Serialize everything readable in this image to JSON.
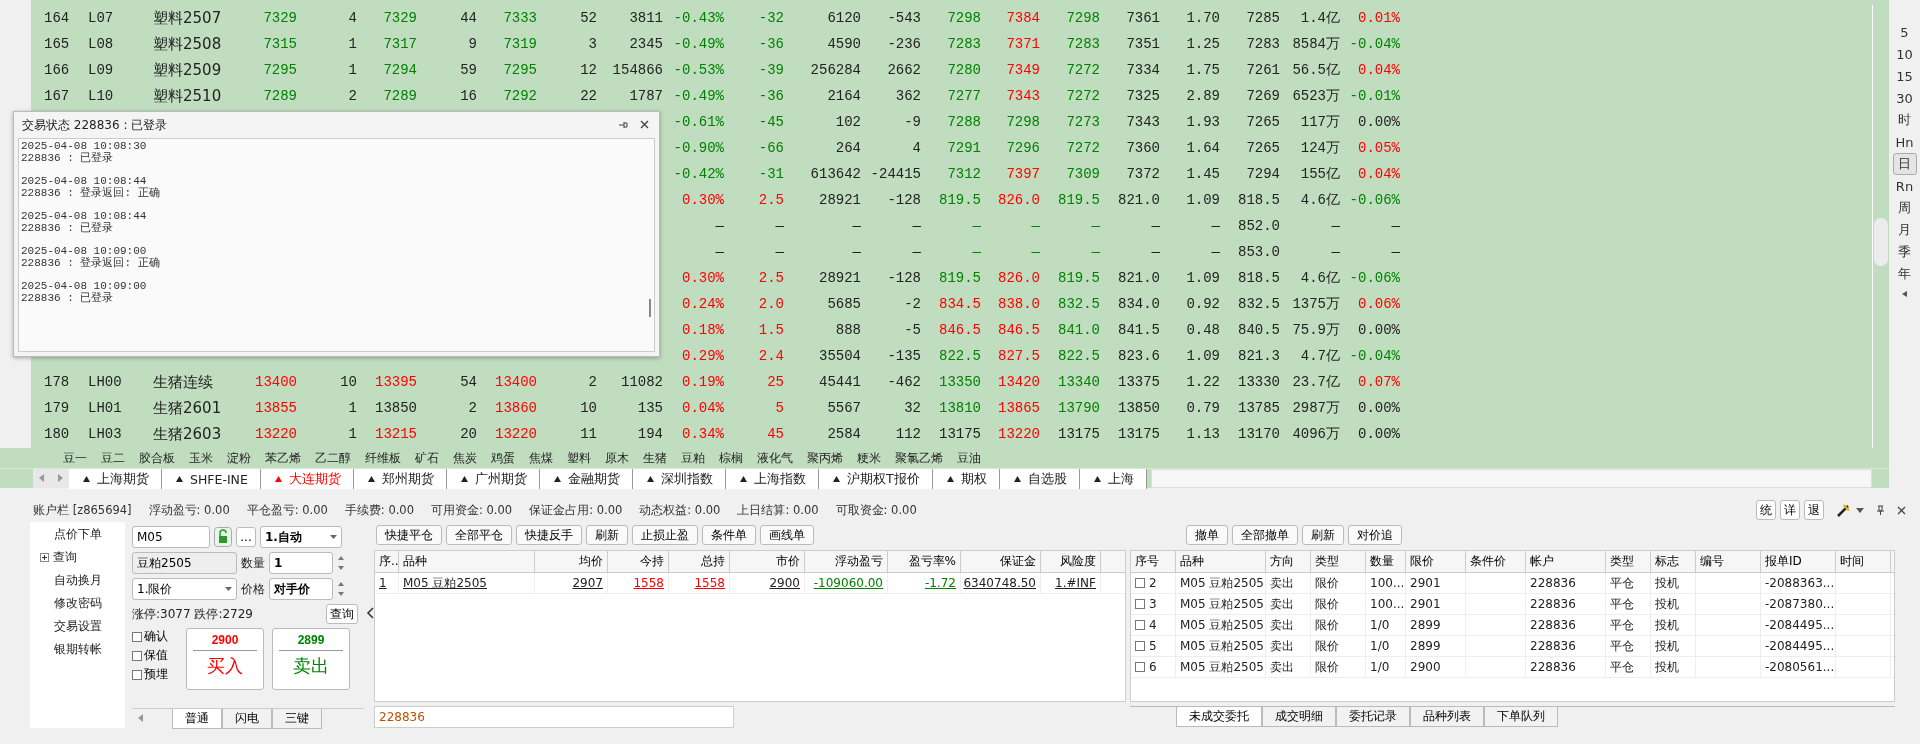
{
  "quotes": {
    "rows": [
      {
        "cells": [
          "164",
          "L07",
          "塑料2507",
          {
            "text": "7329",
            "color": "#008000"
          },
          "4",
          {
            "text": "7329",
            "color": "#008000"
          },
          "44",
          {
            "text": "7333",
            "color": "#008000"
          },
          "52",
          "3811",
          {
            "text": "-0.43%",
            "color": "#008000"
          },
          {
            "text": "-32",
            "color": "#008000"
          },
          "6120",
          "-543",
          {
            "text": "7298",
            "color": "#008000"
          },
          {
            "text": "7384",
            "color": "#ff0000"
          },
          {
            "text": "7298",
            "color": "#008000"
          },
          "7361",
          "1.70",
          "7285",
          "1.4亿",
          {
            "text": "0.01%",
            "color": "#ff0000"
          }
        ]
      },
      {
        "cells": [
          "165",
          "L08",
          "塑料2508",
          {
            "text": "7315",
            "color": "#008000"
          },
          "1",
          {
            "text": "7317",
            "color": "#008000"
          },
          "9",
          {
            "text": "7319",
            "color": "#008000"
          },
          "3",
          "2345",
          {
            "text": "-0.49%",
            "color": "#008000"
          },
          {
            "text": "-36",
            "color": "#008000"
          },
          "4590",
          "-236",
          {
            "text": "7283",
            "color": "#008000"
          },
          {
            "text": "7371",
            "color": "#ff0000"
          },
          {
            "text": "7283",
            "color": "#008000"
          },
          "7351",
          "1.25",
          "7283",
          "8584万",
          {
            "text": "-0.04%",
            "color": "#008000"
          }
        ]
      },
      {
        "cells": [
          "166",
          "L09",
          "塑料2509",
          {
            "text": "7295",
            "color": "#008000"
          },
          "1",
          {
            "text": "7294",
            "color": "#008000"
          },
          "59",
          {
            "text": "7295",
            "color": "#008000"
          },
          "12",
          "154866",
          {
            "text": "-0.53%",
            "color": "#008000"
          },
          {
            "text": "-39",
            "color": "#008000"
          },
          "256284",
          "2662",
          {
            "text": "7280",
            "color": "#008000"
          },
          {
            "text": "7349",
            "color": "#ff0000"
          },
          {
            "text": "7272",
            "color": "#008000"
          },
          "7334",
          "1.75",
          "7261",
          "56.5亿",
          {
            "text": "0.04%",
            "color": "#ff0000"
          }
        ]
      },
      {
        "cells": [
          "167",
          "L10",
          "塑料2510",
          {
            "text": "7289",
            "color": "#008000"
          },
          "2",
          {
            "text": "7289",
            "color": "#008000"
          },
          "16",
          {
            "text": "7292",
            "color": "#008000"
          },
          "22",
          "1787",
          {
            "text": "-0.49%",
            "color": "#008000"
          },
          {
            "text": "-36",
            "color": "#008000"
          },
          "2164",
          "362",
          {
            "text": "7277",
            "color": "#008000"
          },
          {
            "text": "7343",
            "color": "#ff0000"
          },
          {
            "text": "7272",
            "color": "#008000"
          },
          "7325",
          "2.89",
          "7269",
          "6523万",
          {
            "text": "-0.01%",
            "color": "#008000"
          }
        ]
      },
      {
        "cells": [
          {
            "text": "-0.61%",
            "color": "#008000"
          },
          {
            "text": "-45",
            "color": "#008000"
          },
          "102",
          "-9",
          {
            "text": "7288",
            "color": "#008000"
          },
          {
            "text": "7298",
            "color": "#008000"
          },
          {
            "text": "7273",
            "color": "#008000"
          },
          "7343",
          "1.93",
          "7265",
          "117万",
          "0.00%"
        ]
      },
      {
        "cells": [
          {
            "text": "-0.90%",
            "color": "#008000"
          },
          {
            "text": "-66",
            "color": "#008000"
          },
          "264",
          "4",
          {
            "text": "7291",
            "color": "#008000"
          },
          {
            "text": "7296",
            "color": "#008000"
          },
          {
            "text": "7272",
            "color": "#008000"
          },
          "7360",
          "1.64",
          "7265",
          "124万",
          {
            "text": "0.05%",
            "color": "#ff0000"
          }
        ]
      },
      {
        "cells": [
          {
            "text": "-0.42%",
            "color": "#008000"
          },
          {
            "text": "-31",
            "color": "#008000"
          },
          "613642",
          "-24415",
          {
            "text": "7312",
            "color": "#008000"
          },
          {
            "text": "7397",
            "color": "#ff0000"
          },
          {
            "text": "7309",
            "color": "#008000"
          },
          "7372",
          "1.45",
          "7294",
          "155亿",
          {
            "text": "0.04%",
            "color": "#ff0000"
          }
        ]
      },
      {
        "cells": [
          {
            "text": "0.30%",
            "color": "#ff0000"
          },
          {
            "text": "2.5",
            "color": "#ff0000"
          },
          "28921",
          "-128",
          {
            "text": "819.5",
            "color": "#008000"
          },
          {
            "text": "826.0",
            "color": "#ff0000"
          },
          {
            "text": "819.5",
            "color": "#008000"
          },
          "821.0",
          "1.09",
          "818.5",
          "4.6亿",
          {
            "text": "-0.06%",
            "color": "#008000"
          }
        ]
      },
      {
        "cells": [
          "—",
          "—",
          "—",
          "—",
          {
            "text": "—",
            "color": "#008000"
          },
          {
            "text": "—",
            "color": "#008000"
          },
          {
            "text": "—",
            "color": "#008000"
          },
          "—",
          "—",
          "852.0",
          "—",
          "—"
        ]
      },
      {
        "cells": [
          "—",
          "—",
          "—",
          "—",
          {
            "text": "—",
            "color": "#008000"
          },
          {
            "text": "—",
            "color": "#008000"
          },
          {
            "text": "—",
            "color": "#008000"
          },
          "—",
          "—",
          "853.0",
          "—",
          "—"
        ]
      },
      {
        "cells": [
          {
            "text": "0.30%",
            "color": "#ff0000"
          },
          {
            "text": "2.5",
            "color": "#ff0000"
          },
          "28921",
          "-128",
          {
            "text": "819.5",
            "color": "#008000"
          },
          {
            "text": "826.0",
            "color": "#ff0000"
          },
          {
            "text": "819.5",
            "color": "#008000"
          },
          "821.0",
          "1.09",
          "818.5",
          "4.6亿",
          {
            "text": "-0.06%",
            "color": "#008000"
          }
        ]
      },
      {
        "cells": [
          {
            "text": "0.24%",
            "color": "#ff0000"
          },
          {
            "text": "2.0",
            "color": "#ff0000"
          },
          "5685",
          "-2",
          {
            "text": "834.5",
            "color": "#ff0000"
          },
          {
            "text": "838.0",
            "color": "#ff0000"
          },
          {
            "text": "832.5",
            "color": "#008000"
          },
          "834.0",
          "0.92",
          "832.5",
          "1375万",
          {
            "text": "0.06%",
            "color": "#ff0000"
          }
        ]
      },
      {
        "cells": [
          {
            "text": "0.18%",
            "color": "#ff0000"
          },
          {
            "text": "1.5",
            "color": "#ff0000"
          },
          "888",
          "-5",
          {
            "text": "846.5",
            "color": "#ff0000"
          },
          {
            "text": "846.5",
            "color": "#ff0000"
          },
          {
            "text": "841.0",
            "color": "#008000"
          },
          "841.5",
          "0.48",
          "840.5",
          "75.9万",
          "0.00%"
        ]
      },
      {
        "cells": [
          {
            "text": "0.29%",
            "color": "#ff0000"
          },
          {
            "text": "2.4",
            "color": "#ff0000"
          },
          "35504",
          "-135",
          {
            "text": "822.5",
            "color": "#008000"
          },
          {
            "text": "827.5",
            "color": "#ff0000"
          },
          {
            "text": "822.5",
            "color": "#008000"
          },
          "823.6",
          "1.09",
          "821.3",
          "4.7亿",
          {
            "text": "-0.04%",
            "color": "#008000"
          }
        ]
      },
      {
        "cells": [
          "178",
          "LH00",
          "生猪连续",
          {
            "text": "13400",
            "color": "#ff0000"
          },
          "10",
          {
            "text": "13395",
            "color": "#ff0000"
          },
          "54",
          {
            "text": "13400",
            "color": "#ff0000"
          },
          "2",
          "11082",
          {
            "text": "0.19%",
            "color": "#ff0000"
          },
          {
            "text": "25",
            "color": "#ff0000"
          },
          "45441",
          "-462",
          {
            "text": "13350",
            "color": "#008000"
          },
          {
            "text": "13420",
            "color": "#ff0000"
          },
          {
            "text": "13340",
            "color": "#008000"
          },
          "13375",
          "1.22",
          "13330",
          "23.7亿",
          {
            "text": "0.07%",
            "color": "#ff0000"
          }
        ]
      },
      {
        "cells": [
          "179",
          "LH01",
          "生猪2601",
          {
            "text": "13855",
            "color": "#ff0000"
          },
          "1",
          "13850",
          "2",
          {
            "text": "13860",
            "color": "#ff0000"
          },
          "10",
          "135",
          {
            "text": "0.04%",
            "color": "#ff0000"
          },
          {
            "text": "5",
            "color": "#ff0000"
          },
          "5567",
          "32",
          {
            "text": "13810",
            "color": "#008000"
          },
          {
            "text": "13865",
            "color": "#ff0000"
          },
          {
            "text": "13790",
            "color": "#008000"
          },
          "13850",
          "0.79",
          "13785",
          "2987万",
          "0.00%"
        ]
      },
      {
        "cells": [
          "180",
          "LH03",
          "生猪2603",
          {
            "text": "13220",
            "color": "#ff0000"
          },
          "1",
          {
            "text": "13215",
            "color": "#ff0000"
          },
          "20",
          {
            "text": "13220",
            "color": "#ff0000"
          },
          "11",
          "194",
          {
            "text": "0.34%",
            "color": "#ff0000"
          },
          {
            "text": "45",
            "color": "#ff0000"
          },
          "2584",
          "112",
          "13175",
          {
            "text": "13220",
            "color": "#ff0000"
          },
          "13175",
          "13175",
          "1.13",
          "13170",
          "4096万",
          "0.00%"
        ]
      }
    ]
  },
  "status_popup": {
    "title": "交易状态 228836 : 已登录",
    "log": [
      {
        "time": "2025-04-08 10:08:30",
        "message": "228836 : 已登录"
      },
      {
        "time": "2025-04-08 10:08:44",
        "message": "228836 : 登录返回: 正确"
      },
      {
        "time": "2025-04-08 10:08:44",
        "message": "228836 : 已登录"
      },
      {
        "time": "2025-04-08 10:09:00",
        "message": "228836 : 登录返回: 正确"
      },
      {
        "time": "2025-04-08 10:09:00",
        "message": "228836 : 已登录"
      }
    ]
  },
  "categories": [
    "豆一",
    "豆二",
    "胶合板",
    "玉米",
    "淀粉",
    "苯乙烯",
    "乙二醇",
    "纤维板",
    "矿石",
    "焦炭",
    "鸡蛋",
    "焦煤",
    "塑料",
    "原木",
    "生猪",
    "豆粕",
    "棕榈",
    "液化气",
    "聚丙烯",
    "粳米",
    "聚氯乙烯",
    "豆油"
  ],
  "market_tabs": [
    {
      "label": "上海期货",
      "selected": false
    },
    {
      "label": "SHFE-INE",
      "selected": false
    },
    {
      "label": "大连期货",
      "selected": true
    },
    {
      "label": "郑州期货",
      "selected": false
    },
    {
      "label": "广州期货",
      "selected": false
    },
    {
      "label": "金融期货",
      "selected": false
    },
    {
      "label": "深圳指数",
      "selected": false
    },
    {
      "label": "上海指数",
      "selected": false
    },
    {
      "label": "沪期权T报价",
      "selected": false
    },
    {
      "label": "期权",
      "selected": false
    },
    {
      "label": "自选股",
      "selected": false
    },
    {
      "label": "上海",
      "selected": false
    }
  ],
  "periods": [
    {
      "label": "5",
      "selected": false
    },
    {
      "label": "10",
      "selected": false
    },
    {
      "label": "15",
      "selected": false
    },
    {
      "label": "30",
      "selected": false
    },
    {
      "label": "时",
      "selected": false
    },
    {
      "label": "Hn",
      "selected": false
    },
    {
      "label": "日",
      "selected": true
    },
    {
      "label": "Rn",
      "selected": false
    },
    {
      "label": "周",
      "selected": false
    },
    {
      "label": "月",
      "selected": false
    },
    {
      "label": "季",
      "selected": false
    },
    {
      "label": "年",
      "selected": false
    }
  ],
  "account_bar": {
    "items": [
      "账户栏 [z865694]",
      "浮动盈亏: 0.00",
      "平仓盈亏: 0.00",
      "手续费: 0.00",
      "可用资金: 0.00",
      "保证金占用: 0.00",
      "动态权益: 0.00",
      "上日结算: 0.00",
      "可取资金: 0.00"
    ],
    "buttons": [
      "统",
      "详",
      "退"
    ]
  },
  "nav": [
    {
      "label": "点价下单",
      "kind": "leaf"
    },
    {
      "label": "查询",
      "kind": "group",
      "expanded": false
    },
    {
      "label": "自动换月",
      "kind": "leaf"
    },
    {
      "label": "修改密码",
      "kind": "leaf"
    },
    {
      "label": "交易设置",
      "kind": "leaf"
    },
    {
      "label": "银期转帐",
      "kind": "leaf"
    }
  ],
  "order_form": {
    "code": "M05",
    "more": "...",
    "mode": "1.自动",
    "product": "豆粕2505",
    "qty_label": "数量",
    "qty": "1",
    "price_type": "1.限价",
    "price_label": "价格",
    "price": "对手价",
    "limits": "涨停:3077 跌停:2729",
    "query": "查询",
    "options": [
      {
        "label": "确认",
        "checked": false
      },
      {
        "label": "保值",
        "checked": false
      },
      {
        "label": "预埋",
        "checked": false
      }
    ],
    "buy": {
      "price": "2900",
      "label": "买入"
    },
    "sell": {
      "price": "2899",
      "label": "卖出"
    },
    "tabs": [
      {
        "label": "普通",
        "selected": true
      },
      {
        "label": "闪电",
        "selected": false
      },
      {
        "label": "三键",
        "selected": false
      }
    ]
  },
  "positions": {
    "buttons": [
      "快捷平仓",
      "全部平仓",
      "快捷反手",
      "刷新",
      "止损止盈",
      "条件单",
      "画线单"
    ],
    "columns": [
      "序..",
      "品种",
      "均价",
      "今持",
      "总持",
      "市价",
      "浮动盈亏",
      "盈亏率%",
      "保证金",
      "风险度"
    ],
    "rows": [
      {
        "cells": [
          "1",
          "M05 豆粕2505",
          "2907",
          {
            "text": "1558",
            "color": "#ff0000"
          },
          {
            "text": "1558",
            "color": "#ff0000"
          },
          "2900",
          {
            "text": "-109060.00",
            "color": "#008000"
          },
          {
            "text": "-1.72",
            "color": "#008000"
          },
          "6340748.50",
          "1.#INF"
        ]
      }
    ],
    "account": "228836"
  },
  "orders": {
    "buttons": [
      "撤单",
      "全部撤单",
      "刷新",
      "对价追"
    ],
    "columns": [
      "序号",
      "品种",
      "方向",
      "类型",
      "数量",
      "限价",
      "条件价",
      "帐户",
      "类型",
      "标志",
      "编号",
      "报单ID",
      "时间"
    ],
    "rows": [
      {
        "checked": false,
        "cells": [
          "2",
          "M05 豆粕2505",
          "卖出",
          "限价",
          "100...",
          "2901",
          null,
          "228836",
          "平仓",
          "投机",
          null,
          "-2088363...",
          null
        ]
      },
      {
        "checked": false,
        "cells": [
          "3",
          "M05 豆粕2505",
          "卖出",
          "限价",
          "100...",
          "2901",
          null,
          "228836",
          "平仓",
          "投机",
          null,
          "-2087380...",
          null
        ]
      },
      {
        "checked": false,
        "cells": [
          "4",
          "M05 豆粕2505",
          "卖出",
          "限价",
          "1/0",
          "2899",
          null,
          "228836",
          "平仓",
          "投机",
          null,
          "-2084495...",
          null
        ]
      },
      {
        "checked": false,
        "cells": [
          "5",
          "M05 豆粕2505",
          "卖出",
          "限价",
          "1/0",
          "2899",
          null,
          "228836",
          "平仓",
          "投机",
          null,
          "-2084495...",
          null
        ]
      },
      {
        "checked": false,
        "cells": [
          "6",
          "M05 豆粕2505",
          "卖出",
          "限价",
          "1/0",
          "2900",
          null,
          "228836",
          "平仓",
          "投机",
          null,
          "-2080561...",
          null
        ]
      }
    ],
    "tabs": [
      {
        "label": "未成交委托",
        "selected": true
      },
      {
        "label": "成交明细",
        "selected": false
      },
      {
        "label": "委托记录",
        "selected": false
      },
      {
        "label": "品种列表",
        "selected": false
      },
      {
        "label": "下单队列",
        "selected": false
      }
    ]
  }
}
